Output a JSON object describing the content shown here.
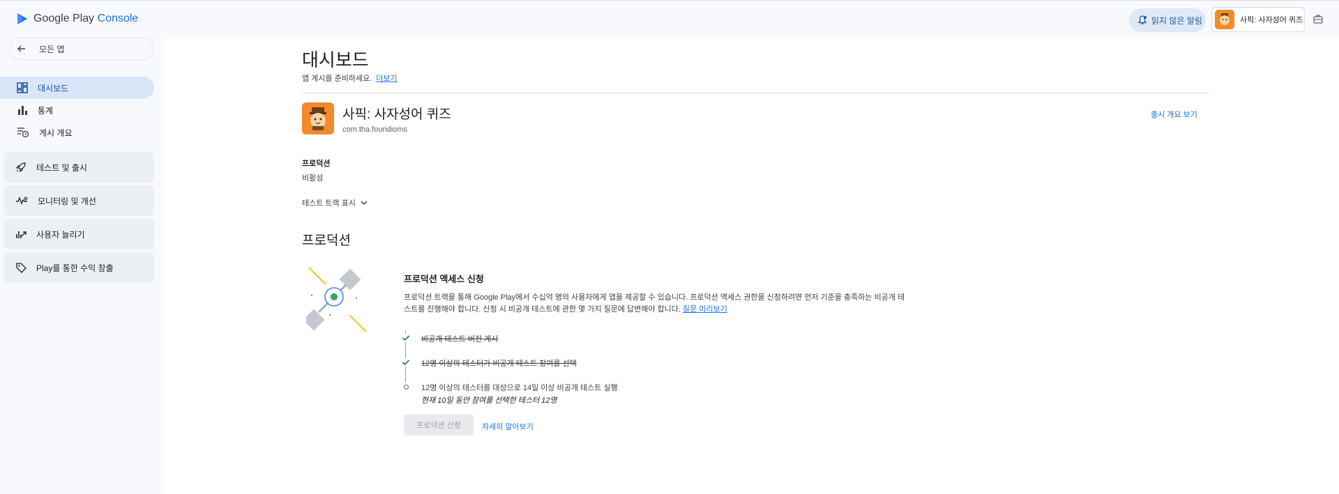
{
  "header": {
    "logo_text_main": "Google Play",
    "logo_text_accent": "Console",
    "notifications_label": "읽지 않은 알림",
    "app_switcher_label": "사픽: 사자성어 퀴즈"
  },
  "sidebar": {
    "back_label": "모든 앱",
    "items": [
      {
        "label": "대시보드"
      },
      {
        "label": "통계"
      },
      {
        "label": "게시 개요"
      }
    ],
    "groups": [
      {
        "label": "테스트 및 출시"
      },
      {
        "label": "모니터링 및 개선"
      },
      {
        "label": "사용자 늘리기"
      },
      {
        "label": "Play를 통한 수익 창출"
      }
    ]
  },
  "main": {
    "title": "대시보드",
    "subtitle": "앱 게시를 준비하세요.",
    "subtitle_link": "더보기",
    "app": {
      "name": "사픽: 사자성어 퀴즈",
      "package": "com.tha.fouridioms",
      "release_overview_link": "출시 개요 보기"
    },
    "production_label": "프로덕션",
    "production_status": "비활성",
    "show_tracks_label": "테스트 트랙 표시",
    "section_title": "프로덕션",
    "card": {
      "title": "프로덕션 액세스 신청",
      "description": "프로덕션 트랙을 통해 Google Play에서 수십억 명의 사용자에게 앱을 제공할 수 있습니다. 프로덕션 액세스 권한을 신청하려면 먼저 기준을 충족하는 비공개 테스트를 진행해야 합니다. 신청 시 비공개 테스트에 관한 몇 가지 질문에 답변해야 합니다.",
      "description_link": "질문 미리보기",
      "steps": [
        {
          "text": "비공개 테스트 버전 게시",
          "done": true
        },
        {
          "text": "12명 이상의 테스터가 비공개 테스트 참여를 선택",
          "done": true
        },
        {
          "text": "12명 이상의 테스터를 대상으로 14일 이상 비공개 테스트 실행",
          "sub": "현재 10일 동안 참여를 선택한 테스터 12명",
          "done": false
        }
      ],
      "apply_button": "프로덕션 신청",
      "learn_more": "자세히 알아보기"
    }
  },
  "colors": {
    "accent": "#1a73e8",
    "app_icon_bg": "#f08a2b",
    "check": "#188038",
    "active_nav_bg": "#d8e6f8"
  }
}
